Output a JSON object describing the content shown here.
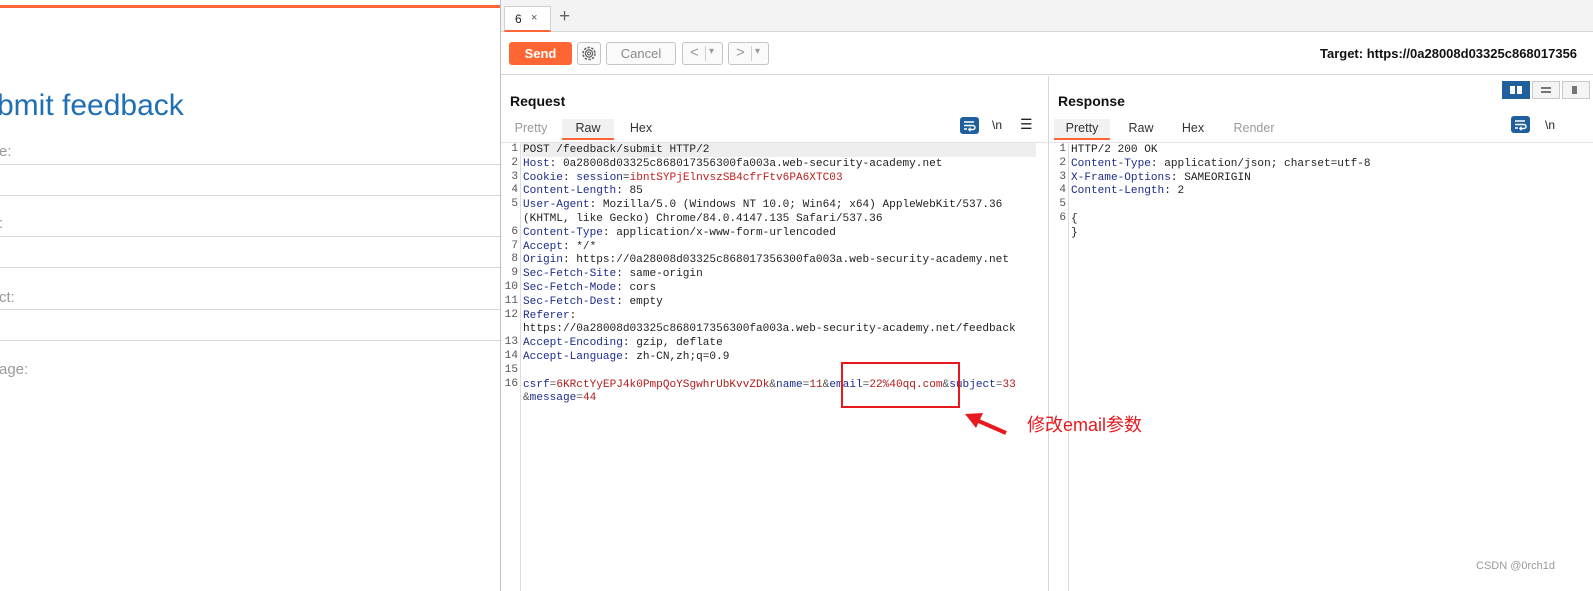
{
  "web": {
    "title": "bmit feedback",
    "fields": [
      {
        "label": "e:"
      },
      {
        "label": ":"
      },
      {
        "label": "ct:"
      },
      {
        "label": "age:"
      }
    ]
  },
  "burp": {
    "tab": {
      "label": "6",
      "close": "×"
    },
    "new_tab": "+",
    "toolbar": {
      "send": "Send",
      "cancel": "Cancel",
      "back": "<",
      "forward": ">",
      "dropdown": "▾",
      "target": "Target: https://0a28008d03325c868017356"
    },
    "request": {
      "title": "Request",
      "tabs": [
        "Pretty",
        "Raw",
        "Hex"
      ],
      "active_tab": "Raw",
      "newline_icon": "\\n",
      "menu_icon": "☰",
      "line_numbers": [
        "1",
        "2",
        "3",
        "4",
        "5",
        "",
        "6",
        "7",
        "8",
        "9",
        "10",
        "11",
        "12",
        "",
        "13",
        "14",
        "15",
        "16",
        ""
      ],
      "lines": [
        {
          "plain": "POST /feedback/submit HTTP/2"
        },
        {
          "key": "Host",
          "val": " 0a28008d03325c868017356300fa003a.web-security-academy.net"
        },
        {
          "key": "Cookie",
          "cookie_name": "session",
          "cookie_val": "ibntSYPjElnvszSB4cfrFtv6PA6XTC03"
        },
        {
          "key": "Content-Length",
          "val": " 85"
        },
        {
          "key": "User-Agent",
          "val": " Mozilla/5.0 (Windows NT 10.0; Win64; x64) AppleWebKit/537.36"
        },
        {
          "plain": "(KHTML, like Gecko) Chrome/84.0.4147.135 Safari/537.36"
        },
        {
          "key": "Content-Type",
          "val": " application/x-www-form-urlencoded"
        },
        {
          "key": "Accept",
          "val": " */*"
        },
        {
          "key": "Origin",
          "val": " https://0a28008d03325c868017356300fa003a.web-security-academy.net"
        },
        {
          "key": "Sec-Fetch-Site",
          "val": " same-origin"
        },
        {
          "key": "Sec-Fetch-Mode",
          "val": " cors"
        },
        {
          "key": "Sec-Fetch-Dest",
          "val": " empty"
        },
        {
          "key": "Referer",
          "val": ""
        },
        {
          "plain": "https://0a28008d03325c868017356300fa003a.web-security-academy.net/feedback"
        },
        {
          "key": "Accept-Encoding",
          "val": " gzip, deflate"
        },
        {
          "key": "Accept-Language",
          "val": " zh-CN,zh;q=0.9"
        },
        {
          "plain": ""
        },
        {
          "params": [
            [
              "csrf",
              "6KRctYyEPJ4k0PmpQoYSgwhrUbKvvZDk"
            ],
            [
              "name",
              "11"
            ],
            [
              "email",
              "22%40qq.com"
            ],
            [
              "subject",
              "33"
            ]
          ]
        },
        {
          "params_cont": [
            [
              "message",
              "44"
            ]
          ]
        }
      ]
    },
    "response": {
      "title": "Response",
      "tabs": [
        "Pretty",
        "Raw",
        "Hex",
        "Render"
      ],
      "active_tab": "Pretty",
      "newline_icon": "\\n",
      "line_numbers": [
        "1",
        "2",
        "3",
        "4",
        "5",
        "6",
        ""
      ],
      "lines": [
        {
          "plain": "HTTP/2 200 OK"
        },
        {
          "key": "Content-Type",
          "val": " application/json; charset=utf-8"
        },
        {
          "key": "X-Frame-Options",
          "val": " SAMEORIGIN"
        },
        {
          "key": "Content-Length",
          "val": " 2"
        },
        {
          "plain": ""
        },
        {
          "plain": "{"
        },
        {
          "plain": "}"
        }
      ]
    }
  },
  "annotation": {
    "text": "修改email参数",
    "color": "#e5191e"
  },
  "watermark": "CSDN @0rch1d",
  "colors": {
    "accent": "#ff6633",
    "link_blue": "#1f6fb4",
    "header_key": "#1c2c8c",
    "param_value": "#b01c1c",
    "icon_blue": "#1f5f9b"
  }
}
